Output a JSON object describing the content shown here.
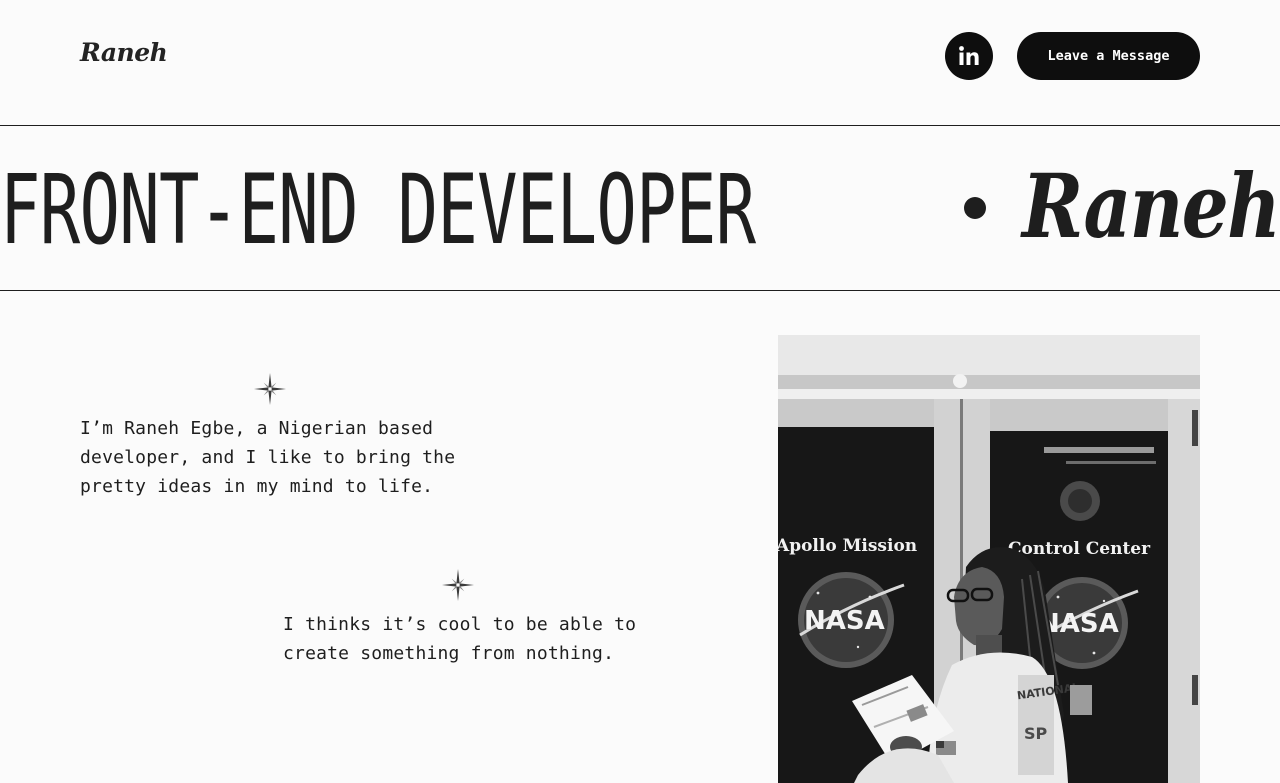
{
  "header": {
    "logo": "Raneh",
    "linkedin_icon": "linkedin-icon",
    "message_button": "Leave a Message"
  },
  "marquee": {
    "title": "FRONT-END DEVELOPER",
    "separator_icon": "bullet-dot",
    "name": "Raneh"
  },
  "intro": {
    "sparkle_icon": "sparkle-star-icon",
    "paragraph_1": "I’m Raneh Egbe, a Nigerian based\ndeveloper, and I like to bring the\npretty ideas in my mind to life.",
    "paragraph_2": "I thinks it’s cool to be able to\ncreate something from nothing."
  },
  "photo": {
    "left_sign": "Apollo Mission",
    "right_sign": "Control Center",
    "logo_text": "NASA"
  },
  "colors": {
    "background": "#fbfbfb",
    "ink": "#1e1e1e",
    "button": "#0e0e0e"
  }
}
